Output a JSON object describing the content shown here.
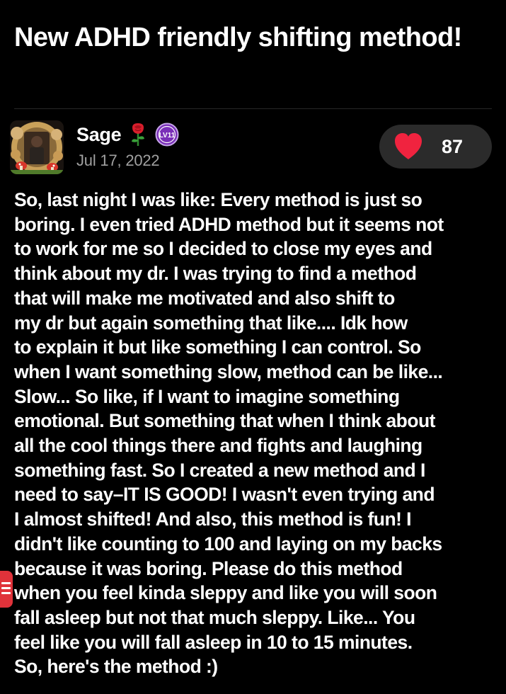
{
  "post": {
    "title": "New ADHD friendly shifting method!",
    "author": {
      "name": "Sage",
      "name_emoji_icon": "rose-icon",
      "level_badge": "LV11",
      "avatar_icon": "mushroom-frame-avatar"
    },
    "date": "Jul 17, 2022",
    "likes": {
      "icon": "heart-icon",
      "count": "87",
      "heart_color": "#f0233f"
    },
    "body_lines": [
      "So, last night I was like: Every method is just so",
      "boring. I even tried ADHD method but it seems not",
      "to work for me so I decided to close my eyes and",
      "think about my dr. I was trying to find a method",
      "that will make me motivated and also shift to",
      "my dr but again something that like.... Idk how",
      "to explain it but like something I can control. So",
      "when I want something slow, method can be like...",
      "Slow... So like, if I want to imagine something",
      "emotional. But something that when I think about",
      "all the cool things there and fights and laughing",
      "something fast. So I created a new method and I",
      "need to say–IT IS GOOD!  I wasn't even trying and",
      "I almost shifted! And also, this method is fun! I",
      "didn't like counting to 100 and laying on my backs",
      "because it was boring. Please do this method",
      "when you feel kinda sleppy and like you will soon",
      "fall asleep but not that much sleppy. Like... You",
      "feel like you will fall asleep in 10 to 15 minutes.",
      "So, here's the method :)"
    ]
  },
  "side_tab": {
    "icon": "menu-icon",
    "color": "#e0323a"
  },
  "colors": {
    "background": "#000000",
    "text": "#ffffff",
    "muted_text": "#a0a0a0",
    "like_pill": "#2b2b2b",
    "level_badge": "#7a2fb8"
  }
}
